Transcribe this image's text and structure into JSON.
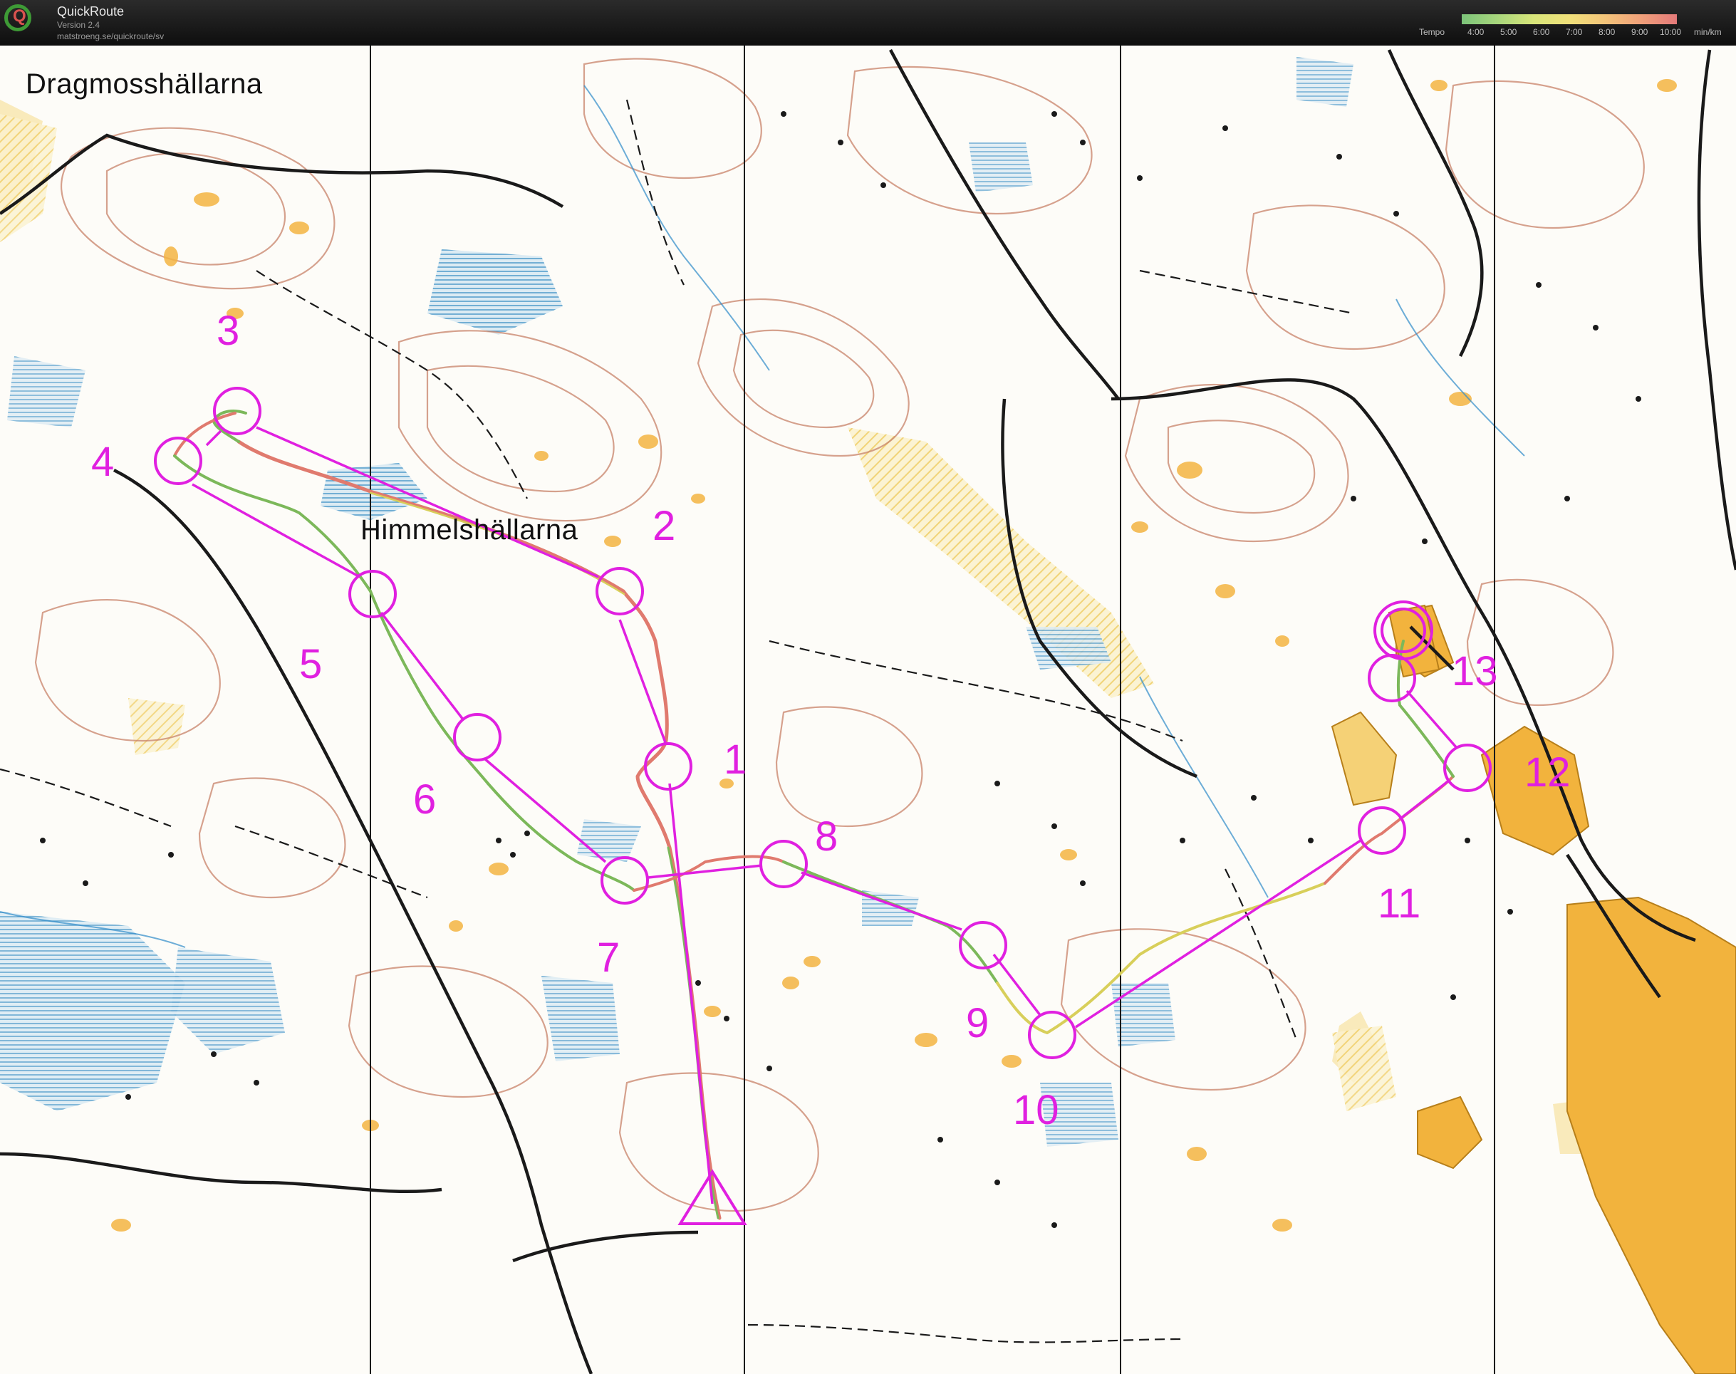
{
  "app": {
    "name": "QuickRoute",
    "version": "Version 2.4",
    "url": "matstroeng.se/quickroute/sv"
  },
  "legend": {
    "label": "Tempo",
    "ticks": [
      "4:00",
      "5:00",
      "6:00",
      "7:00",
      "8:00",
      "9:00",
      "10:00"
    ],
    "unit": "min/km",
    "colors": [
      "#7cc47a",
      "#a8d67c",
      "#d8e57a",
      "#f0e07a",
      "#f3c47a",
      "#f0a07a",
      "#e47a7a"
    ]
  },
  "map": {
    "place_names": {
      "dragmoss": "Dragmosshällarna",
      "himmel": "Himmelshällarna"
    },
    "course_color": "#e020e0",
    "controls": [
      "1",
      "2",
      "3",
      "4",
      "5",
      "6",
      "7",
      "8",
      "9",
      "10",
      "11",
      "12",
      "13"
    ]
  }
}
